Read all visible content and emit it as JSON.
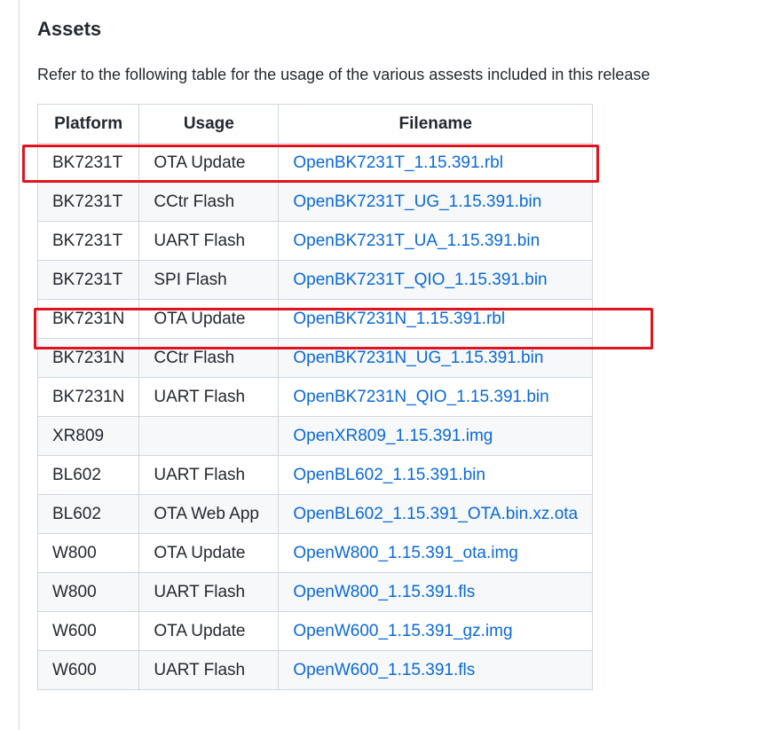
{
  "section": {
    "title": "Assets",
    "description": "Refer to the following table for the usage of the various assests included in this release"
  },
  "table": {
    "headers": [
      "Platform",
      "Usage",
      "Filename"
    ],
    "rows": [
      {
        "platform": "BK7231T",
        "usage": "OTA Update",
        "filename": "OpenBK7231T_1.15.391.rbl"
      },
      {
        "platform": "BK7231T",
        "usage": "CCtr Flash",
        "filename": "OpenBK7231T_UG_1.15.391.bin"
      },
      {
        "platform": "BK7231T",
        "usage": "UART Flash",
        "filename": "OpenBK7231T_UA_1.15.391.bin"
      },
      {
        "platform": "BK7231T",
        "usage": "SPI Flash",
        "filename": "OpenBK7231T_QIO_1.15.391.bin"
      },
      {
        "platform": "BK7231N",
        "usage": "OTA Update",
        "filename": "OpenBK7231N_1.15.391.rbl"
      },
      {
        "platform": "BK7231N",
        "usage": "CCtr Flash",
        "filename": "OpenBK7231N_UG_1.15.391.bin"
      },
      {
        "platform": "BK7231N",
        "usage": "UART Flash",
        "filename": "OpenBK7231N_QIO_1.15.391.bin"
      },
      {
        "platform": "XR809",
        "usage": "",
        "filename": "OpenXR809_1.15.391.img"
      },
      {
        "platform": "BL602",
        "usage": "UART Flash",
        "filename": "OpenBL602_1.15.391.bin"
      },
      {
        "platform": "BL602",
        "usage": "OTA Web App",
        "filename": "OpenBL602_1.15.391_OTA.bin.xz.ota"
      },
      {
        "platform": "W800",
        "usage": "OTA Update",
        "filename": "OpenW800_1.15.391_ota.img"
      },
      {
        "platform": "W800",
        "usage": "UART Flash",
        "filename": "OpenW800_1.15.391.fls"
      },
      {
        "platform": "W600",
        "usage": "OTA Update",
        "filename": "OpenW600_1.15.391_gz.img"
      },
      {
        "platform": "W600",
        "usage": "UART Flash",
        "filename": "OpenW600_1.15.391.fls"
      }
    ]
  },
  "colors": {
    "link": "#0969da",
    "highlight_border": "#e0141e",
    "table_border": "#d0d7de",
    "row_stripe": "#f6f8fa"
  }
}
